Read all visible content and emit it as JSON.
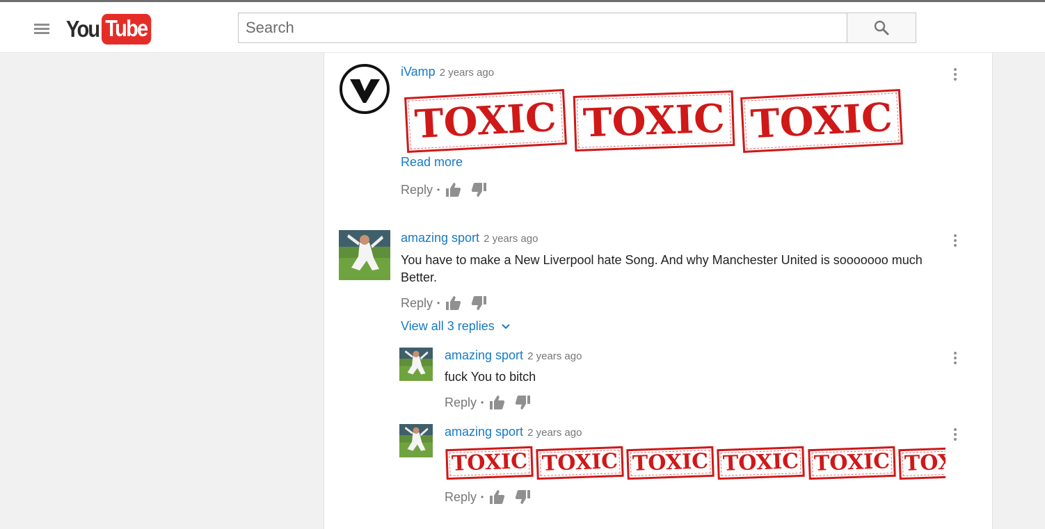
{
  "header": {
    "logo_you": "You",
    "logo_tube": "Tube",
    "search_placeholder": "Search"
  },
  "comments": [
    {
      "author": "iVamp",
      "time": "2 years ago",
      "image_word": "TOXIC",
      "read_more": "Read more",
      "reply": "Reply"
    },
    {
      "author": "amazing sport",
      "time": "2 years ago",
      "text": "You have to make a New Liverpool hate Song. And why Manchester United is sooooooo much Better.",
      "reply": "Reply",
      "view_replies": "View all 3 replies",
      "replies": [
        {
          "author": "amazing sport",
          "time": "2 years ago",
          "text": "fuck You to bitch",
          "reply": "Reply"
        },
        {
          "author": "amazing sport",
          "time": "2 years ago",
          "image_word": "TOXIC",
          "reply": "Reply"
        }
      ]
    }
  ],
  "colors": {
    "link": "#167ac6",
    "logo_red": "#e52d27",
    "stamp_red": "#d01818"
  }
}
